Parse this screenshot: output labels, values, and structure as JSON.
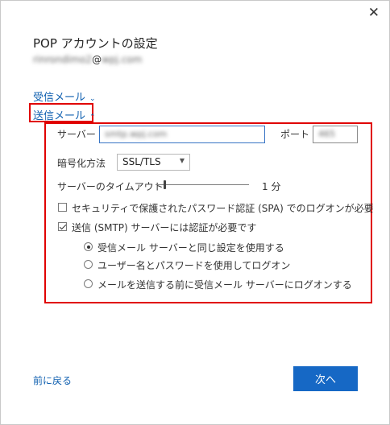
{
  "dialog": {
    "title": "POP アカウントの設定",
    "email_local": "rinrondimo2",
    "email_at": "@",
    "email_domain": "wpj.com",
    "close_glyph": "✕"
  },
  "incoming": {
    "label": "受信メール",
    "chevron": "⌄"
  },
  "outgoing": {
    "label": "送信メール",
    "chevron": "⌃",
    "server_label": "サーバー",
    "server_value": "smtp.wpj.com",
    "port_label": "ポート",
    "port_value": "465",
    "encryption_label": "暗号化方法",
    "encryption_value": "SSL/TLS",
    "timeout_label": "サーバーのタイムアウト",
    "timeout_value": "1 分",
    "timeout_level": 0.1,
    "spa_label": "セキュリティで保護されたパスワード認証 (SPA) でのログオンが必要",
    "spa_checked": false,
    "smtp_auth_label": "送信 (SMTP) サーバーには認証が必要です",
    "smtp_auth_checked": true,
    "radio_options": [
      {
        "label": "受信メール サーバーと同じ設定を使用する",
        "checked": true
      },
      {
        "label": "ユーザー名とパスワードを使用してログオン",
        "checked": false
      },
      {
        "label": "メールを送信する前に受信メール サーバーにログオンする",
        "checked": false
      }
    ]
  },
  "footer": {
    "back_label": "前に戻る",
    "next_label": "次へ"
  },
  "colors": {
    "accent": "#1668c5",
    "link": "#1060b0",
    "highlight": "#e00000"
  }
}
